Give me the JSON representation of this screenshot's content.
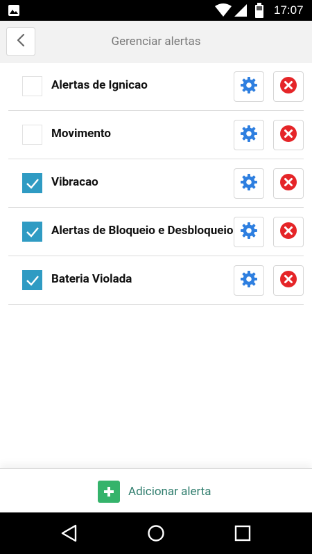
{
  "status_bar": {
    "time": "17:07",
    "icons": [
      "image-icon",
      "wifi-icon",
      "signal-icon",
      "battery-icon"
    ]
  },
  "header": {
    "title": "Gerenciar alertas",
    "back_icon": "chevron-left-icon"
  },
  "alerts": [
    {
      "label": "Alertas de Ignicao",
      "checked": false
    },
    {
      "label": "Movimento",
      "checked": false
    },
    {
      "label": "Vibracao",
      "checked": true
    },
    {
      "label": "Alertas de Bloqueio e Desbloqueio",
      "checked": true
    },
    {
      "label": "Bateria Violada",
      "checked": true
    }
  ],
  "row_icons": {
    "settings": "gear-icon",
    "delete": "remove-x-icon"
  },
  "footer": {
    "add_label": "Adicionar alerta",
    "add_icon": "plus-icon"
  },
  "nav_bar": {
    "icons": [
      "nav-back-icon",
      "nav-home-icon",
      "nav-recents-icon"
    ]
  },
  "colors": {
    "checkbox_checked": "#2f9bc3",
    "gear": "#2e7fe0",
    "delete": "#e52528",
    "add_button": "#35b36b",
    "add_text": "#2f7d6d",
    "header_bg": "#f2f2f2",
    "title_text": "#7a7a7a"
  }
}
